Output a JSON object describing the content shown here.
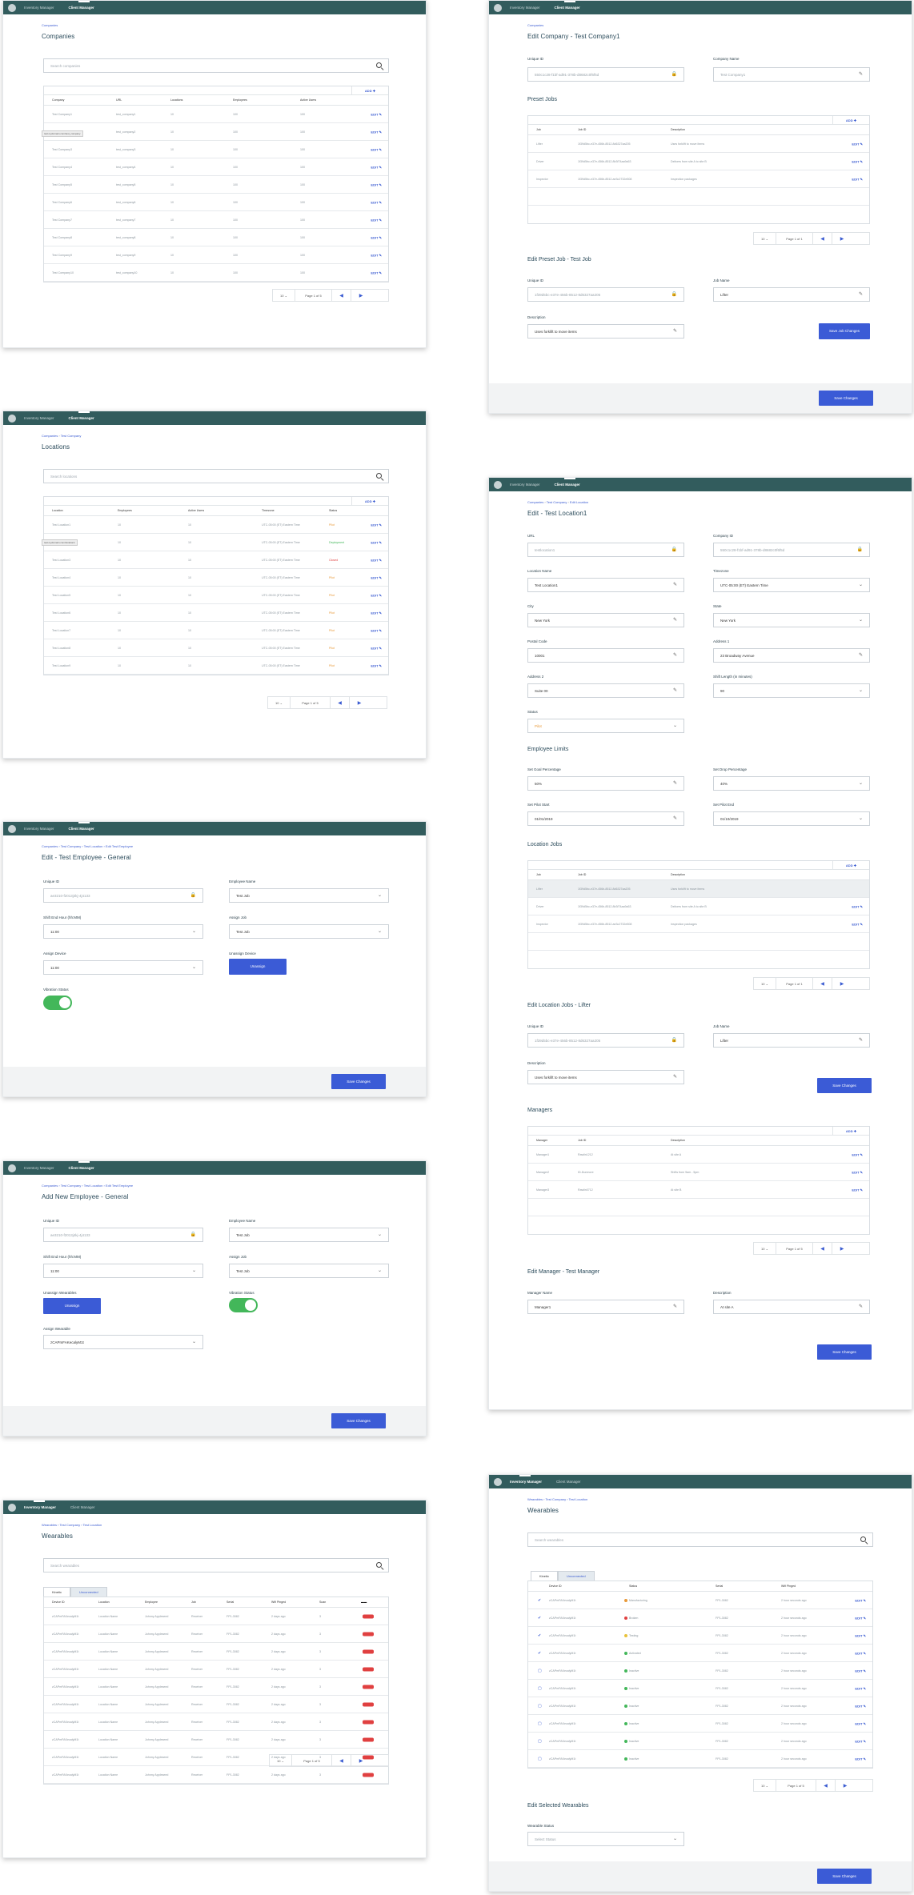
{
  "nav": {
    "inventory": "Inventory Manager",
    "client": "Client Manager"
  },
  "common": {
    "edit": "EDIT",
    "add": "ADD",
    "save": "Save Changes",
    "page_size": "10",
    "prev": "◀",
    "next": "▶"
  },
  "companies": {
    "crumb": "Companies",
    "title": "Companies",
    "search_placeholder": "Search companies",
    "page": "Page 1 of 5",
    "headers": [
      "Company",
      "URL",
      "Locations",
      "Employees",
      "Active Users"
    ],
    "tooltip": "test.mydomain.com/test_company",
    "rows": [
      [
        "Test Company1",
        "test_company1",
        "10",
        "100",
        "100"
      ],
      [
        "Test Company2",
        "test_company2",
        "10",
        "100",
        "100"
      ],
      [
        "Test Company3",
        "test_company3",
        "10",
        "100",
        "100"
      ],
      [
        "Test Company4",
        "test_company4",
        "10",
        "100",
        "100"
      ],
      [
        "Test Company5",
        "test_company5",
        "10",
        "100",
        "100"
      ],
      [
        "Test Company6",
        "test_company6",
        "10",
        "100",
        "100"
      ],
      [
        "Test Company7",
        "test_company7",
        "10",
        "100",
        "100"
      ],
      [
        "Test Company8",
        "test_company8",
        "10",
        "100",
        "100"
      ],
      [
        "Test Company9",
        "test_company9",
        "10",
        "100",
        "100"
      ],
      [
        "Test Company10",
        "test_company10",
        "10",
        "100",
        "100"
      ]
    ]
  },
  "edit_company": {
    "crumb": "Companies",
    "title": "Edit Company - Test Company1",
    "uid_label": "Unique ID",
    "uid": "550c1c28-f1bf-ad91-378b-d8682c0f6f5d",
    "name_label": "Company Name",
    "name": "Test Company1",
    "preset_title": "Preset Jobs",
    "headers": [
      "Job",
      "Job ID",
      "Description"
    ],
    "rows": [
      [
        "Lifter",
        "1f39d5bc-e37e-456b-8512-8d6327aa205",
        "Uses forklift to move items"
      ],
      [
        "Driver",
        "1f39d5bc-e37e-456b-8512-8b3f74aa9a53",
        "Delivers from site A to site B"
      ],
      [
        "Inspector",
        "1f39d5bc-e37e-456b-8512-ae3c2732e508",
        "Inspection packages"
      ]
    ],
    "page": "Page 1 of 1",
    "edit_preset_title": "Edit Preset Job - Test Job",
    "job_uid_label": "Unique ID",
    "job_uid": "1f39d5bc-e37e-456b-8512-8d6327aa205",
    "job_name_label": "Job Name",
    "job_name": "Lifter",
    "desc_label": "Description",
    "desc": "Uses forklift to move items",
    "save_job": "Save Job Changes"
  },
  "locations": {
    "crumb1": "Companies",
    "crumb2": "Test Company",
    "title": "Locations",
    "search_placeholder": "Search locations",
    "page": "Page 1 of 5",
    "headers": [
      "Location",
      "Employees",
      "Active Users",
      "Timezone",
      "Status"
    ],
    "tooltip": "test.mydomain.com/location1",
    "rows": [
      [
        "Test Location1",
        "10",
        "10",
        "UTC-05:00 (ET) Eastern Time",
        "Pilot"
      ],
      [
        "Test Location2",
        "10",
        "10",
        "UTC-05:00 (ET) Eastern Time",
        "Deployment"
      ],
      [
        "Test Location3",
        "10",
        "10",
        "UTC-05:00 (ET) Eastern Time",
        "Closed"
      ],
      [
        "Test Location4",
        "10",
        "10",
        "UTC-05:00 (ET) Eastern Time",
        "Pilot"
      ],
      [
        "Test Location5",
        "10",
        "10",
        "UTC-05:00 (ET) Eastern Time",
        "Pilot"
      ],
      [
        "Test Location6",
        "10",
        "10",
        "UTC-05:00 (ET) Eastern Time",
        "Pilot"
      ],
      [
        "Test Location7",
        "10",
        "10",
        "UTC-05:00 (ET) Eastern Time",
        "Pilot"
      ],
      [
        "Test Location8",
        "10",
        "10",
        "UTC-05:00 (ET) Eastern Time",
        "Pilot"
      ],
      [
        "Test Location9",
        "10",
        "10",
        "UTC-05:00 (ET) Eastern Time",
        "Pilot"
      ]
    ]
  },
  "edit_location": {
    "crumb1": "Companies",
    "crumb2": "Test Company",
    "crumb3": "Edit Location",
    "title": "Edit - Test Location1",
    "url_label": "URL",
    "url": "testlocation1",
    "cid_label": "Company ID",
    "cid": "550c1c28-f1bf-ad91-378b-d8682c0f6f5d",
    "lname_label": "Location Name",
    "lname": "Test Location1",
    "tz_label": "Timezone",
    "tz": "UTC-05:00 (ET) Eastern Time",
    "city_label": "City",
    "city": "New York",
    "state_label": "State",
    "state": "New York",
    "postal_label": "Postal Code",
    "postal": "10001",
    "addr1_label": "Address 1",
    "addr1": "23 Broadway Avenue",
    "addr2_label": "Address 2",
    "addr2": "Suite 00",
    "shift_label": "Shift Length (in minutes)",
    "shift": "90",
    "status_label": "Status",
    "status": "Pilot",
    "limits_title": "Employee Limits",
    "goal_label": "Set Goal Percentage",
    "goal": "50%",
    "drop_label": "Set Drop Percentage",
    "drop": "40%",
    "pstart_label": "Set Pilot Start",
    "pstart": "01/01/2019",
    "pend_label": "Set Pilot End",
    "pend": "01/10/2019",
    "jobs_title": "Location Jobs",
    "job_headers": [
      "Job",
      "Job ID",
      "Description"
    ],
    "job_rows": [
      [
        "Lifter",
        "1f39d5bc-e37e-456b-8512-8d6327aa205",
        "Uses forklift to move items"
      ],
      [
        "Driver",
        "1f39d5bc-e37e-456b-8512-8b3f74aa9a53",
        "Delivers from site A to site B"
      ],
      [
        "Inspector",
        "1f39d5bc-e37e-456b-8512-ae3c2732e508",
        "Inspection packages"
      ]
    ],
    "job_page": "Page 1 of 1",
    "edit_jobs_title": "Edit Location Jobs - Lifter",
    "ej_uid_label": "Unique ID",
    "ej_uid": "1f39d5bc-e37e-456b-8512-8d6327aa205",
    "ej_name_label": "Job Name",
    "ej_name": "Lifter",
    "ej_desc_label": "Description",
    "ej_desc": "Uses forklift to move items",
    "managers_title": "Managers",
    "mgr_headers": [
      "Manager",
      "Job ID",
      "Description"
    ],
    "mgr_rows": [
      [
        "Manager1",
        "Rawlin1212",
        "At site A"
      ],
      [
        "Manager2",
        "ID-Dunmore",
        "Shifts from 9am - 5pm"
      ],
      [
        "Manager3",
        "Rawlin0712",
        "At site B"
      ]
    ],
    "mgr_page": "Page 1 of 5",
    "edit_mgr_title": "Edit Manager - Test Manager",
    "mname_label": "Manager Name",
    "mname": "Manager1",
    "mdesc_label": "Description",
    "mdesc": "At site A"
  },
  "edit_employee": {
    "crumb1": "Companies",
    "crumb2": "Test Company",
    "crumb3": "Test Location",
    "crumb4": "Edit Test Employee",
    "title": "Edit - Test Employee - General",
    "uid_label": "Unique ID",
    "uid": "ae3210-f2013j4kj-4j4133",
    "ename_label": "Employee Name",
    "ename": "Test Job",
    "shift_label": "Shift End Hour (hh:MM)",
    "shift": "11:00",
    "job_label": "Assign Job",
    "job": "Test Job",
    "device_label": "Assign Device",
    "device": "11:00",
    "unassign_label": "Unassign Device",
    "unassign": "Unassign",
    "vib_label": "Vibration Status"
  },
  "add_employee": {
    "crumb1": "Companies",
    "crumb2": "Test Company",
    "crumb3": "Test Location",
    "crumb4": "Edit Test Employee",
    "title": "Add New Employee - General",
    "uid_label": "Unique ID",
    "uid": "ae3210-f2013j4kj-4j4133",
    "ename_label": "Employee Name",
    "ename": "Test Job",
    "shift_label": "Shift End Hour (hh:MM)",
    "shift": "11:00",
    "job_label": "Assign Job",
    "job": "Test Job",
    "unassign_label": "Unassign Wearables",
    "unassign": "Unassign",
    "vib_label": "Vibration Status",
    "wear_label": "Assign Wearable",
    "wear": "zCAPmFAKecalyM1t"
  },
  "wearables1": {
    "crumb1": "Wearables",
    "crumb2": "Test Company",
    "crumb3": "Test Location",
    "title": "Wearables",
    "search_placeholder": "Search wearables",
    "tab1": "Kinetic",
    "tab2": "Unconnected",
    "page": "Page 1 of 5",
    "headers": [
      "Device ID",
      "Location",
      "Employee",
      "Job",
      "Serial",
      "Wifi Pinged",
      "Scan"
    ],
    "rows": [
      [
        "zCAPmFAKecalyM1t",
        "Location Name",
        "Johnny Appleseed",
        "Receiver",
        "FP1-3082",
        "2 days ago",
        "3"
      ],
      [
        "zCAPmFAKecalyM1t",
        "Location Name",
        "Johnny Appleseed",
        "Receiver",
        "FP1-3082",
        "2 days ago",
        "3"
      ],
      [
        "zCAPmFAKecalyM1t",
        "Location Name",
        "Johnny Appleseed",
        "Receiver",
        "FP1-3082",
        "2 days ago",
        "3"
      ],
      [
        "zCAPmFAKecalyM1t",
        "Location Name",
        "Johnny Appleseed",
        "Receiver",
        "FP1-3082",
        "2 days ago",
        "3"
      ],
      [
        "zCAPmFAKecalyM1t",
        "Location Name",
        "Johnny Appleseed",
        "Receiver",
        "FP1-3082",
        "2 days ago",
        "3"
      ],
      [
        "zCAPmFAKecalyM1t",
        "Location Name",
        "Johnny Appleseed",
        "Receiver",
        "FP1-3082",
        "2 days ago",
        "3"
      ],
      [
        "zCAPmFAKecalyM1t",
        "Location Name",
        "Johnny Appleseed",
        "Receiver",
        "FP1-3082",
        "2 days ago",
        "3"
      ],
      [
        "zCAPmFAKecalyM1t",
        "Location Name",
        "Johnny Appleseed",
        "Receiver",
        "FP1-3082",
        "2 days ago",
        "3"
      ],
      [
        "zCAPmFAKecalyM1t",
        "Location Name",
        "Johnny Appleseed",
        "Receiver",
        "FP1-3082",
        "2 days ago",
        "3"
      ],
      [
        "zCAPmFAKecalyM1t",
        "Location Name",
        "Johnny Appleseed",
        "Receiver",
        "FP1-3082",
        "2 days ago",
        "3"
      ]
    ]
  },
  "wearables2": {
    "crumb1": "Wearables",
    "crumb2": "Test Company",
    "crumb3": "Test Location",
    "title": "Wearables",
    "search_placeholder": "Search wearables",
    "tab1": "Kinetic",
    "tab2": "Unconnected",
    "page": "Page 1 of 5",
    "headers": [
      "Device ID",
      "Status",
      "Serial",
      "Wifi Pinged"
    ],
    "rows": [
      [
        "zCAPmFAKecalyM1t",
        "Manufacturing",
        "FP1-3082",
        "2 hour seconds ago",
        "#e89a3a",
        true
      ],
      [
        "zCAPmFAKecalyM1t",
        "Broken",
        "FP1-3082",
        "2 hour seconds ago",
        "#e04040",
        true
      ],
      [
        "zCAPmFAKecalyM1t",
        "Testing",
        "FP1-3082",
        "2 hour seconds ago",
        "#e8c23a",
        true
      ],
      [
        "zCAPmFAKecalyM1t",
        "Activated",
        "FP1-3082",
        "2 hour seconds ago",
        "#43b75a",
        true
      ],
      [
        "zCAPmFAKecalyM1t",
        "Inactive",
        "FP1-3082",
        "2 hour seconds ago",
        "#43b75a",
        false
      ],
      [
        "zCAPmFAKecalyM1t",
        "Inactive",
        "FP1-3082",
        "2 hour seconds ago",
        "#43b75a",
        false
      ],
      [
        "zCAPmFAKecalyM1t",
        "Inactive",
        "FP1-3082",
        "2 hour seconds ago",
        "#43b75a",
        false
      ],
      [
        "zCAPmFAKecalyM1t",
        "Inactive",
        "FP1-3082",
        "2 hour seconds ago",
        "#43b75a",
        false
      ],
      [
        "zCAPmFAKecalyM1t",
        "Inactive",
        "FP1-3082",
        "2 hour seconds ago",
        "#43b75a",
        false
      ],
      [
        "zCAPmFAKecalyM1t",
        "Inactive",
        "FP1-3082",
        "2 hour seconds ago",
        "#43b75a",
        false
      ]
    ],
    "sel_title": "Edit Selected Wearables",
    "status_label": "Wearable Status",
    "status_placeholder": "Select Status"
  }
}
